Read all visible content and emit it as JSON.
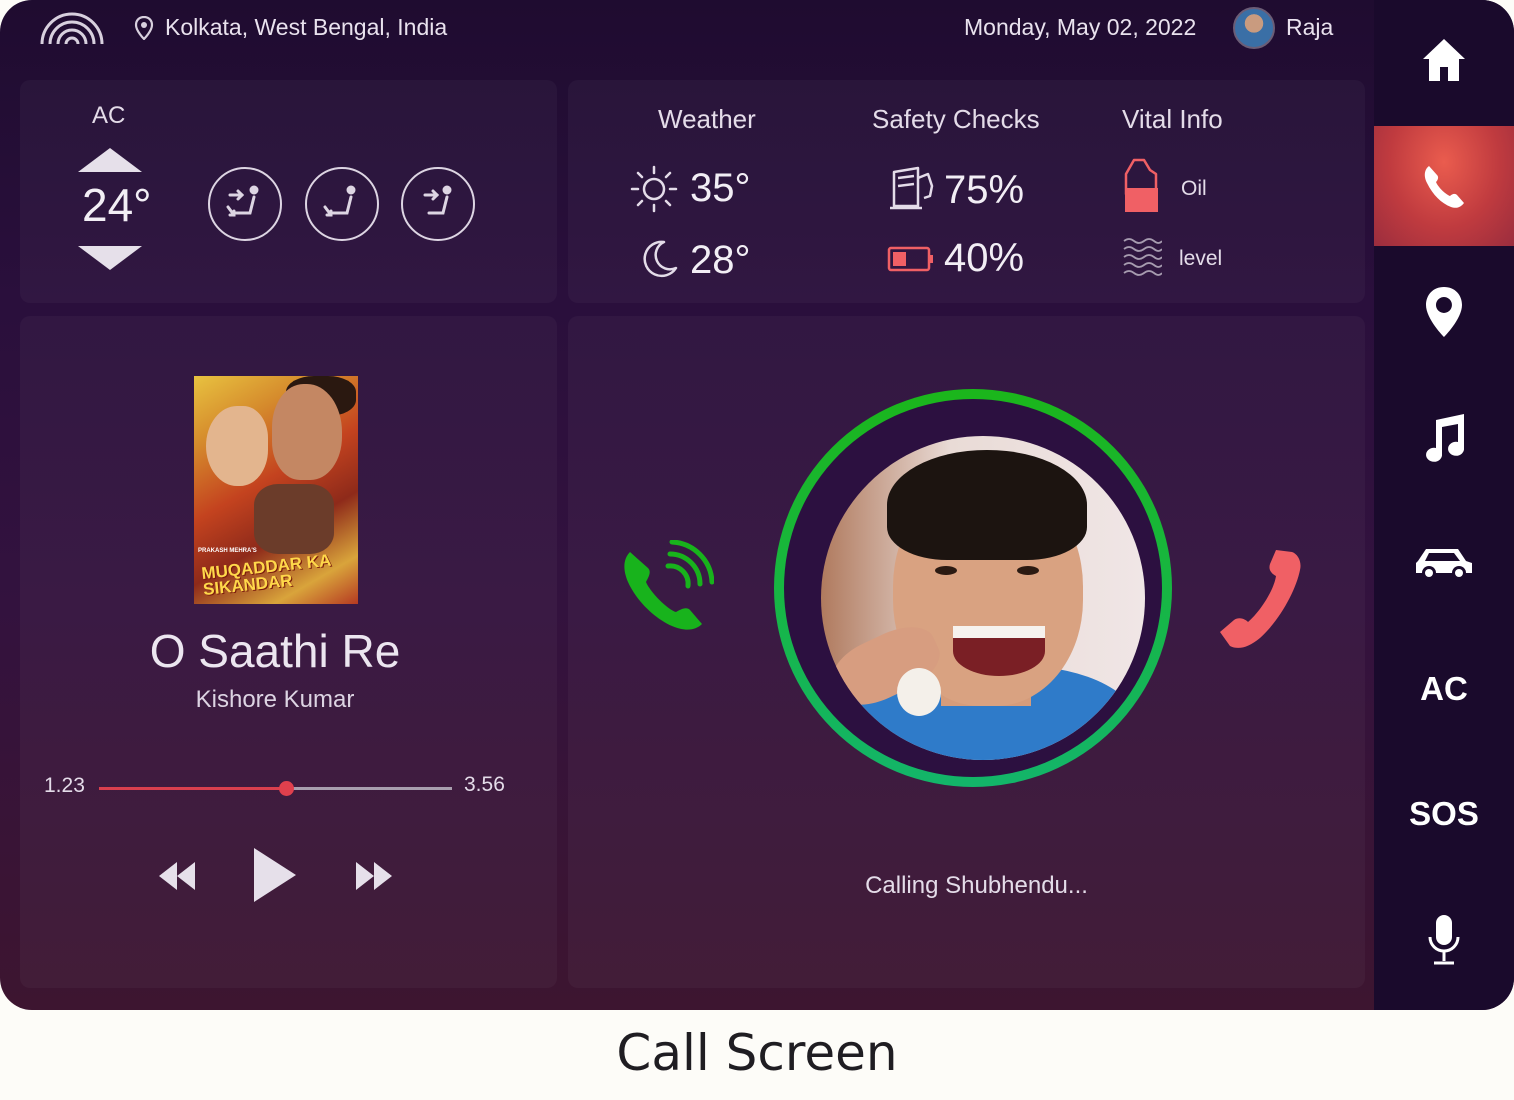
{
  "header": {
    "location": "Kolkata, West Bengal, India",
    "date": "Monday, May 02, 2022",
    "user_name": "Raja"
  },
  "ac": {
    "label": "AC",
    "temperature": "24°"
  },
  "info": {
    "weather_title": "Weather",
    "day_temp": "35°",
    "night_temp": "28°",
    "safety_title": "Safety Checks",
    "fuel": "75%",
    "battery": "40%",
    "vital_title": "Vital Info",
    "oil_label": "Oil",
    "level_label": "level"
  },
  "music": {
    "album_subtitle": "PRAKASH MEHRA'S",
    "album_title": "MUQADDAR KA SIKANDAR",
    "song": "O Saathi Re",
    "artist": "Kishore Kumar",
    "elapsed": "1.23",
    "duration": "3.56",
    "progress": 0.53
  },
  "call": {
    "status": "Calling Shubhendu..."
  },
  "sidebar": {
    "items": [
      {
        "icon": "home-icon"
      },
      {
        "icon": "phone-icon",
        "active": true
      },
      {
        "icon": "location-icon"
      },
      {
        "icon": "music-icon"
      },
      {
        "icon": "car-icon"
      },
      {
        "label": "AC"
      },
      {
        "label": "SOS"
      },
      {
        "icon": "microphone-icon"
      }
    ]
  },
  "caption": "Call Screen",
  "colors": {
    "accent": "#e0404d",
    "call_ring": "#1bb61b",
    "accept": "#18b31c",
    "decline": "#f06065"
  }
}
